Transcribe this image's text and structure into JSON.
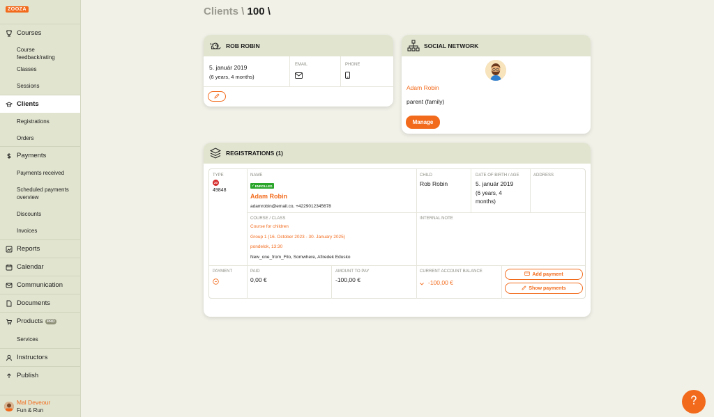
{
  "app": {
    "logo_text": "ZOOZA"
  },
  "sidebar": {
    "sections": [
      {
        "label": "Courses",
        "icon": "trophy-icon"
      },
      {
        "label": "Clients",
        "icon": "clients-icon"
      },
      {
        "label": "Payments",
        "icon": "dollar-icon"
      },
      {
        "label": "Reports",
        "icon": "chart-icon"
      },
      {
        "label": "Calendar",
        "icon": "calendar-icon"
      },
      {
        "label": "Communication",
        "icon": "mail-icon"
      },
      {
        "label": "Documents",
        "icon": "document-icon"
      },
      {
        "label": "Products",
        "icon": "cart-icon",
        "badge": "PRO"
      },
      {
        "label": "Instructors",
        "icon": "user-icon"
      }
    ],
    "courses_sub": [
      "Course feedback/rating",
      "Classes",
      "Sessions"
    ],
    "clients_sub": [
      "Registrations",
      "Orders"
    ],
    "payments_sub": [
      "Payments received",
      "Scheduled payments overview",
      "Discounts",
      "Invoices"
    ],
    "products_sub": [
      "Services"
    ],
    "partial_item": "Publish"
  },
  "user": {
    "name": "Mal Deveour",
    "org": "Fun & Run"
  },
  "header": {
    "title_prefix": "Clients \\ ",
    "title_id": "100 \\"
  },
  "client_card": {
    "title": "ROB ROBIN",
    "birth_date": "5. január 2019",
    "age": "(6 years, 4 months)",
    "email_label": "EMAIL",
    "phone_label": "PHONE"
  },
  "social_card": {
    "title": "SOCIAL NETWORK",
    "person_name": "Adam Robin",
    "relation": "parent (family)",
    "manage_label": "Manage"
  },
  "registrations": {
    "title": "REGISTRATIONS (1)",
    "type_label": "TYPE",
    "type_badge": "20",
    "reg_id": "49848",
    "name_label": "NAME",
    "status_badge": "ENROLLED",
    "name": "Adam Robin",
    "contact": "adamrobin@email.co, +4229012345678",
    "child_label": "CHILD",
    "child": "Rob Robin",
    "dob_label": "DATE OF BIRTH / AGE",
    "dob": "5. január 2019",
    "dob_age": "(6 years, 4 months)",
    "address_label": "ADDRESS",
    "course_label": "COURSE / CLASS",
    "course": "Course for children",
    "group": "Group 1 (16. October 2023 - 30. January 2025)",
    "schedule": "pondelok, 13:30",
    "location": "New_one_from_Filo, Somwhere, Afiredek Edusko",
    "note_label": "INTERNAL NOTE",
    "payment_label": "PAYMENT",
    "paid_label": "PAID",
    "paid": "0,00 €",
    "amount_label": "AMOUNT TO PAY",
    "amount": "-100,00 €",
    "balance_label": "CURRENT ACCOUNT BALANCE",
    "balance": "-100,00 €",
    "add_payment": "Add payment",
    "show_payments": "Show payments"
  },
  "colors": {
    "accent": "#f26a1b",
    "sidebar": "#e1e4cf",
    "background": "#f1f1e8",
    "enrolled": "#2aa52a"
  }
}
